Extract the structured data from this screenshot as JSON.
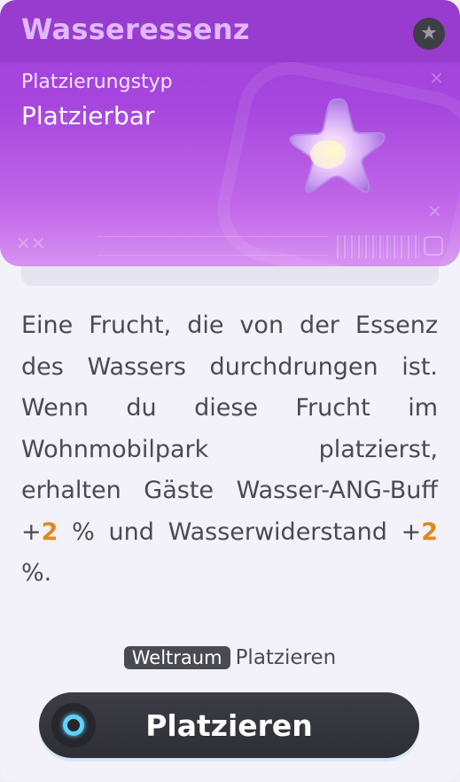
{
  "header": {
    "title": "Wasseressenz",
    "placement_type_label": "Platzierungstyp",
    "placement_type_value": "Platzierbar"
  },
  "description": {
    "before_1": "Eine Frucht, die von der Essenz des Wassers durchdrungen ist. Wenn du diese Frucht im Wohnmobilpark platzierst, erhalten Gäste Wasser-ANG-Buff +",
    "value_1": "2",
    "between": " % und Wasserwiderstand +",
    "value_2": "2",
    "after_2": " %."
  },
  "hint": {
    "tag": "Weltraum",
    "text": "Platzieren"
  },
  "action_button": {
    "label": "Platzieren",
    "icon": "controller-button-icon"
  },
  "icons": {
    "favorite": "star-icon",
    "item": "purple-star-fruit-icon"
  },
  "colors": {
    "header_purple": "#a646de",
    "title_lilac": "#e0b8ff",
    "highlight_orange": "#e08a1a",
    "button_dark": "#35353c",
    "accent_cyan": "#5fd2ff"
  }
}
